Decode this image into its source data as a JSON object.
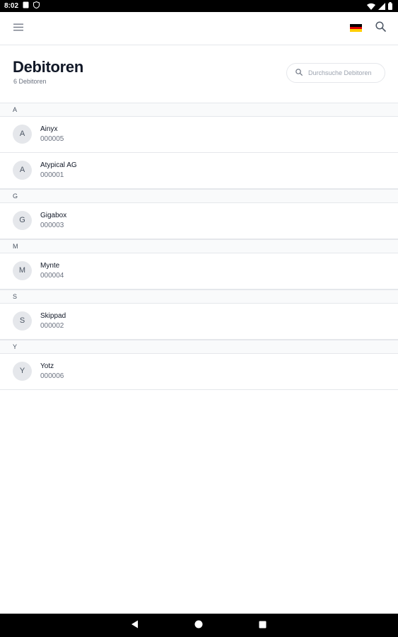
{
  "status_bar": {
    "time": "8:02"
  },
  "app_bar": {
    "language_flag": "flag-de-icon"
  },
  "header": {
    "title": "Debitoren",
    "count": "6 Debitoren",
    "search_placeholder": "Durchsuche Debitoren"
  },
  "sections": [
    {
      "letter": "A",
      "items": [
        {
          "initial": "A",
          "name": "Ainyx",
          "number": "000005"
        },
        {
          "initial": "A",
          "name": "Atypical AG",
          "number": "000001"
        }
      ]
    },
    {
      "letter": "G",
      "items": [
        {
          "initial": "G",
          "name": "Gigabox",
          "number": "000003"
        }
      ]
    },
    {
      "letter": "M",
      "items": [
        {
          "initial": "M",
          "name": "Mynte",
          "number": "000004"
        }
      ]
    },
    {
      "letter": "S",
      "items": [
        {
          "initial": "S",
          "name": "Skippad",
          "number": "000002"
        }
      ]
    },
    {
      "letter": "Y",
      "items": [
        {
          "initial": "Y",
          "name": "Yotz",
          "number": "000006"
        }
      ]
    }
  ],
  "colors": {
    "flag_black": "#000000",
    "flag_red": "#dd0000",
    "flag_gold": "#ffce00",
    "divider": "#e5e7eb",
    "section_bg": "#f9fafb",
    "avatar_bg": "#e5e7eb"
  }
}
